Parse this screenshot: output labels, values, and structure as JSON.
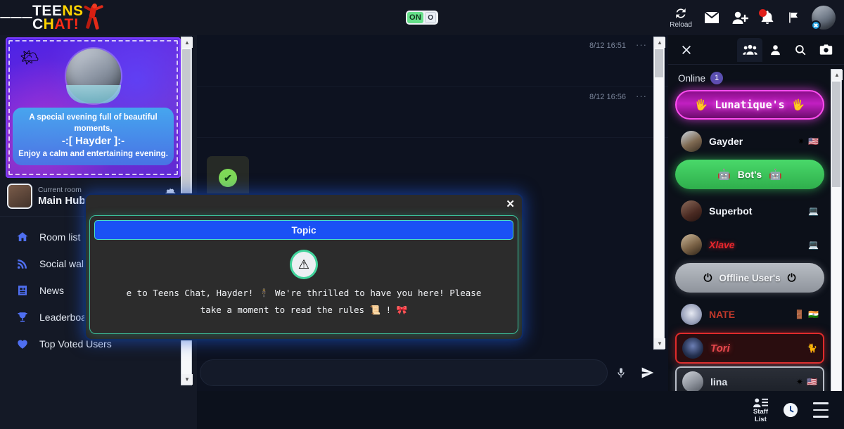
{
  "header": {
    "menu_icon": "hamburger-icon",
    "logo": {
      "line1_a": "TEE",
      "line1_b": "NS",
      "line2_a": "C",
      "line2_b": "H",
      "line2_c": "AT!"
    },
    "toggle": {
      "on_label": "ON",
      "knob_label": "O"
    },
    "icons": [
      {
        "name": "reload-icon",
        "label": "Reload"
      },
      {
        "name": "mail-icon",
        "label": ""
      },
      {
        "name": "add-user-icon",
        "label": ""
      },
      {
        "name": "bell-icon",
        "label": ""
      },
      {
        "name": "flag-icon",
        "label": ""
      }
    ],
    "avatar_badge": "✖"
  },
  "sidebar": {
    "banner": {
      "weather_icon": "🌤",
      "line1": "A special evening full of beautiful moments,",
      "line2": "-:[ Hayder ]:-",
      "line3": "Enjoy a calm and entertaining evening."
    },
    "room": {
      "label": "Current room",
      "name": "Main Hub",
      "settings_icon": "gear-icon"
    },
    "items": [
      {
        "label": "Room list",
        "icon": "home-icon"
      },
      {
        "label": "Social wall",
        "icon": "rss-icon"
      },
      {
        "label": "News",
        "icon": "news-icon"
      },
      {
        "label": "Leaderboard",
        "icon": "trophy-icon"
      },
      {
        "label": "Top Voted Users",
        "icon": "heart-icon"
      }
    ]
  },
  "chat": {
    "messages": [
      {
        "timestamp": "8/12 16:51",
        "menu": "···"
      },
      {
        "timestamp": "8/12 16:56",
        "menu": "···"
      }
    ],
    "status_tick": "✔",
    "composer": {
      "placeholder": "",
      "value": "",
      "mic_icon": "microphone-icon",
      "send_icon": "send-icon"
    }
  },
  "modal": {
    "close_label": "✕",
    "topic_label": "Topic",
    "warning_icon": "⚠",
    "body_line1": "e to Teens Chat, Hayder! 🕴 We're thrilled to have you here! Please",
    "body_line2": "take a moment to read the rules 📜 ! 🎀"
  },
  "right_panel": {
    "close_label": "✕",
    "tabs": [
      {
        "name": "group-icon",
        "selected": true
      },
      {
        "name": "person-icon",
        "selected": false
      },
      {
        "name": "search-icon",
        "selected": false
      },
      {
        "name": "camera-icon",
        "selected": false
      }
    ],
    "online_label": "Online",
    "online_count": "1",
    "groups": [
      {
        "type": "pill",
        "style": "lunatique",
        "label": "Lunatique's",
        "side_icon": "🖐"
      },
      {
        "type": "user",
        "style": "gayder",
        "name": "Gayder",
        "badges": [
          "✷",
          "🇺🇸"
        ]
      },
      {
        "type": "pill",
        "style": "bots",
        "label": "Bot's",
        "side_icon": "🤖"
      },
      {
        "type": "user",
        "style": "superbot",
        "name": "Superbot",
        "badges": [
          "💻"
        ]
      },
      {
        "type": "user",
        "style": "xlave",
        "name": "Xlave",
        "badges": [
          "💻"
        ]
      },
      {
        "type": "pill",
        "style": "offline",
        "label": "Offline User's",
        "side_icon": "⏻"
      },
      {
        "type": "user",
        "style": "nate",
        "name": "NATE",
        "badges": [
          "🚪",
          "🇮🇳"
        ]
      },
      {
        "type": "user",
        "style": "tori",
        "name": "Tori",
        "badges": [
          "🐈"
        ]
      },
      {
        "type": "user",
        "style": "lina",
        "name": "lina",
        "badges": [
          "✷",
          "🇺🇸"
        ]
      }
    ]
  },
  "bottom_bar": {
    "staff_list_label_line1": "Staff",
    "staff_list_label_line2": "List",
    "clock_icon": "clock-icon",
    "menu_icon": "hamburger-icon"
  }
}
